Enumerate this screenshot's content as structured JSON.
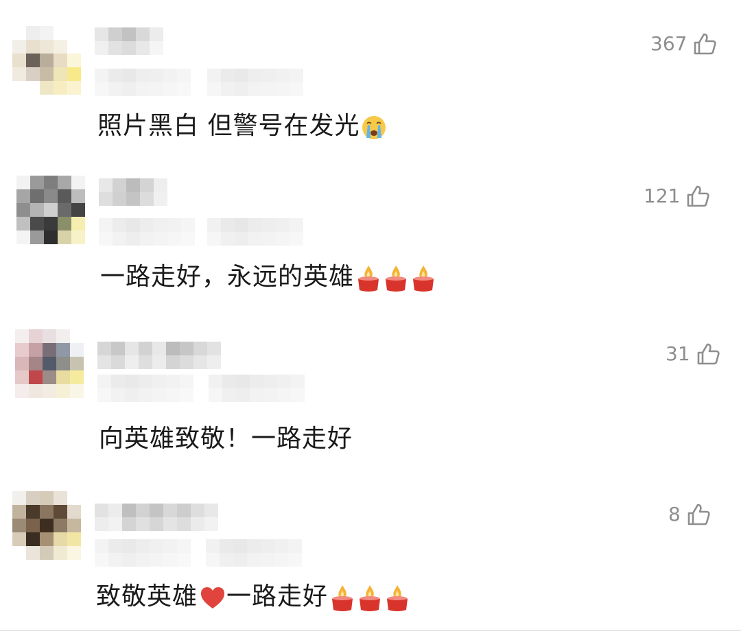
{
  "comments": [
    {
      "likes": "367",
      "text": "照片黑白 但警号在发光",
      "emoji": "crying-face"
    },
    {
      "likes": "121",
      "text": "一路走好，永远的英雄",
      "emoji": "candles"
    },
    {
      "likes": "31",
      "text": "向英雄致敬！一路走好",
      "emoji": ""
    },
    {
      "likes": "8",
      "text_before": "致敬英雄",
      "text_after": "一路走好",
      "emoji": "heart-and-candles"
    }
  ],
  "colors": {
    "like_gray": "#8e8e8e",
    "text": "#1a1a1a",
    "candle_red": "#d9342b",
    "flame": "#f5b335",
    "heart": "#e0443c"
  }
}
